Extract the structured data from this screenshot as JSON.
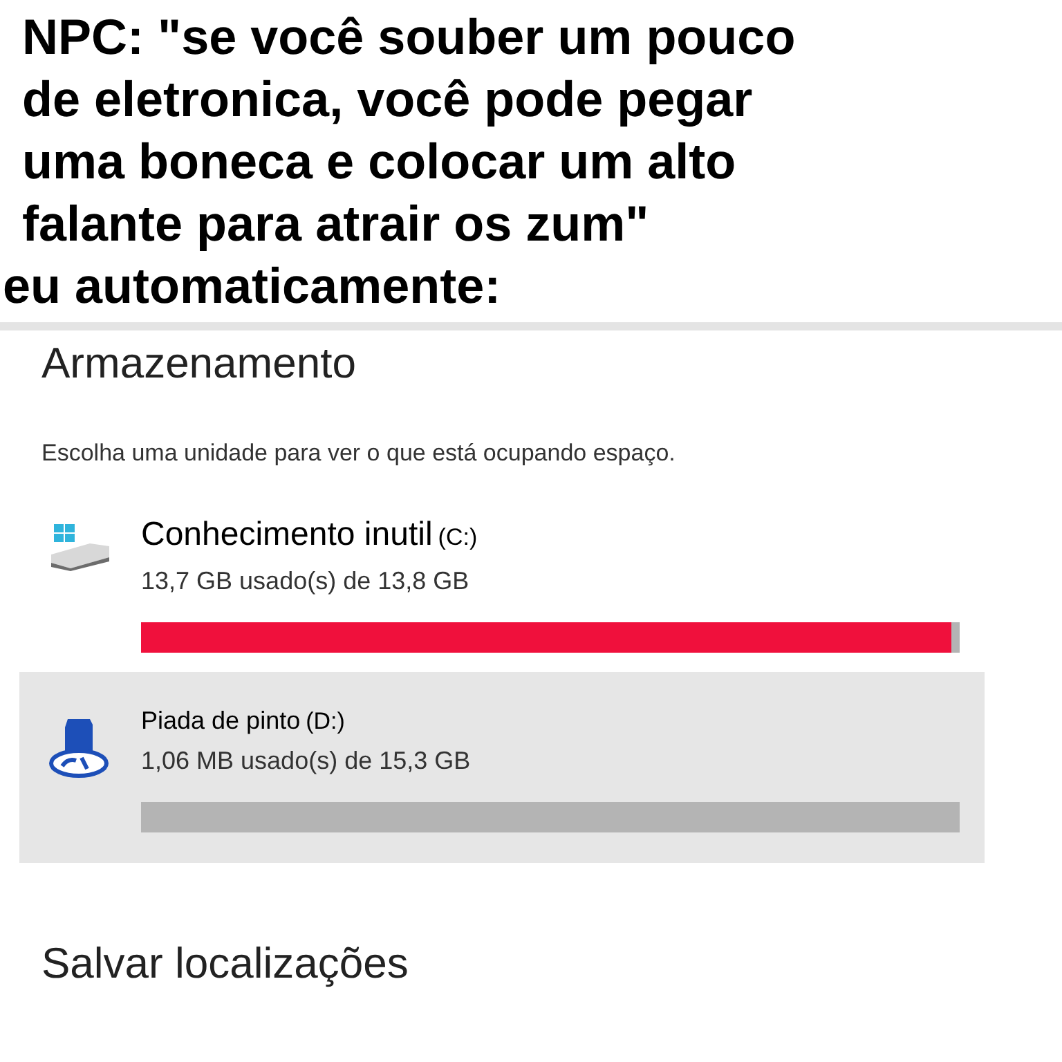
{
  "caption": {
    "quote": "NPC: \"se você souber um pouco de eletronica, você pode pegar uma boneca e colocar um alto falante para atrair os zum\"",
    "reaction": "eu automaticamente:"
  },
  "storage": {
    "title": "Armazenamento",
    "subtitle": "Escolha uma unidade para ver o que está ocupando espaço.",
    "drives": [
      {
        "kind": "system",
        "name": "Conhecimento inutil",
        "letter": "(C:)",
        "usage": "13,7 GB usado(s) de 13,8 GB",
        "level": 0.99,
        "color": "#f0103c",
        "selected": false
      },
      {
        "kind": "sd",
        "name": "Piada de pinto",
        "letter": "(D:)",
        "usage": "1,06 MB usado(s) de 15,3 GB",
        "selected": true
      }
    ],
    "section": "Salvar localizações"
  }
}
